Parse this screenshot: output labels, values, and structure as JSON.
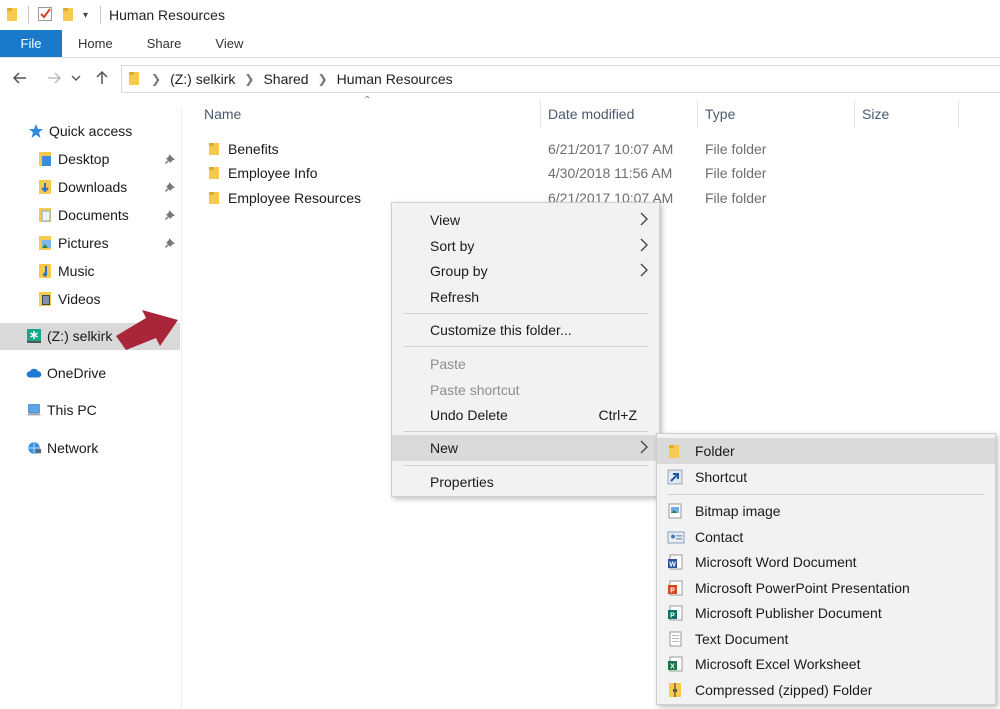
{
  "window": {
    "title": "Human Resources"
  },
  "ribbon": {
    "tabs": [
      "File",
      "Home",
      "Share",
      "View"
    ]
  },
  "address": {
    "crumbs": [
      "(Z:) selkirk",
      "Shared",
      "Human Resources"
    ]
  },
  "sidebar": {
    "quick_access": "Quick access",
    "items": [
      "Desktop",
      "Downloads",
      "Documents",
      "Pictures",
      "Music",
      "Videos"
    ],
    "drive": "(Z:) selkirk",
    "onedrive": "OneDrive",
    "thispc": "This PC",
    "network": "Network"
  },
  "columns": {
    "name": "Name",
    "date": "Date modified",
    "type": "Type",
    "size": "Size"
  },
  "files": [
    {
      "name": "Benefits",
      "date": "6/21/2017 10:07 AM",
      "type": "File folder"
    },
    {
      "name": "Employee Info",
      "date": "4/30/2018 11:56 AM",
      "type": "File folder"
    },
    {
      "name": "Employee Resources",
      "date": "6/21/2017 10:07 AM",
      "type": "File folder"
    }
  ],
  "context_menu": {
    "view": "View",
    "sort_by": "Sort by",
    "group_by": "Group by",
    "refresh": "Refresh",
    "customize": "Customize this folder...",
    "paste": "Paste",
    "paste_shortcut": "Paste shortcut",
    "undo_delete": "Undo Delete",
    "undo_shortcut": "Ctrl+Z",
    "new": "New",
    "properties": "Properties"
  },
  "new_submenu": {
    "folder": "Folder",
    "shortcut": "Shortcut",
    "bitmap": "Bitmap image",
    "contact": "Contact",
    "word": "Microsoft Word Document",
    "powerpoint": "Microsoft PowerPoint Presentation",
    "publisher": "Microsoft Publisher Document",
    "text": "Text Document",
    "excel": "Microsoft Excel Worksheet",
    "zip": "Compressed (zipped) Folder"
  },
  "colors": {
    "accent": "#1979ca",
    "folder": "#f6c94f",
    "arrow": "#a8253a"
  }
}
